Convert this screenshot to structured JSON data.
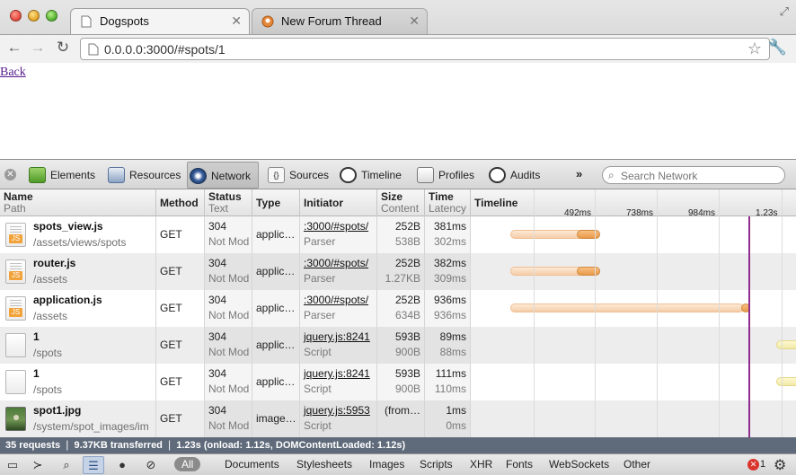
{
  "browser": {
    "tabs": [
      {
        "title": "Dogspots",
        "active": true
      },
      {
        "title": "New Forum Thread",
        "active": false
      }
    ],
    "url": "0.0.0.0:3000/#spots/1"
  },
  "page": {
    "back_link": "Back"
  },
  "devtools": {
    "panels": [
      "Elements",
      "Resources",
      "Network",
      "Sources",
      "Timeline",
      "Profiles",
      "Audits"
    ],
    "selected_panel": "Network",
    "overflow": "»",
    "search_placeholder": "Search Network",
    "columns": {
      "name": "Name",
      "path": "Path",
      "method": "Method",
      "status": "Status",
      "status_text": "Text",
      "type": "Type",
      "initiator": "Initiator",
      "size": "Size",
      "content": "Content",
      "time": "Time",
      "latency": "Latency",
      "timeline": "Timeline"
    },
    "timeline_ticks": [
      "492ms",
      "738ms",
      "984ms",
      "1.23s"
    ],
    "rows": [
      {
        "name": "spots_view.js",
        "path": "/assets/views/spots",
        "method": "GET",
        "status": "304",
        "status_text": "Not Mod",
        "type": "applic…",
        "initiator": ":3000/#spots/",
        "initiator_type": "Parser",
        "size": "252B",
        "content": "538B",
        "time": "381ms",
        "latency": "302ms",
        "icon": "js",
        "bar": {
          "kind": "js",
          "start": 0.0,
          "mid": 0.66,
          "end": 0.89
        }
      },
      {
        "name": "router.js",
        "path": "/assets",
        "method": "GET",
        "status": "304",
        "status_text": "Not Mod",
        "type": "applic…",
        "initiator": ":3000/#spots/",
        "initiator_type": "Parser",
        "size": "252B",
        "content": "1.27KB",
        "time": "382ms",
        "latency": "309ms",
        "icon": "js",
        "bar": {
          "kind": "js",
          "start": 0.0,
          "mid": 0.66,
          "end": 0.89
        }
      },
      {
        "name": "application.js",
        "path": "/assets",
        "method": "GET",
        "status": "304",
        "status_text": "Not Mod",
        "type": "applic…",
        "initiator": ":3000/#spots/",
        "initiator_type": "Parser",
        "size": "252B",
        "content": "634B",
        "time": "936ms",
        "latency": "936ms",
        "icon": "js",
        "bar": {
          "kind": "js",
          "start": 0.0,
          "mid": 0.99,
          "end": 1.0
        }
      },
      {
        "name": "1",
        "path": "/spots",
        "method": "GET",
        "status": "304",
        "status_text": "Not Mod",
        "type": "applic…",
        "initiator": "jquery.js:8241",
        "initiator_type": "Script",
        "size": "593B",
        "content": "900B",
        "time": "89ms",
        "latency": "88ms",
        "icon": "blank",
        "bar": {
          "kind": "xhr",
          "start": 0.0,
          "mid": 0.82,
          "end": 1.0
        }
      },
      {
        "name": "1",
        "path": "/spots",
        "method": "GET",
        "status": "304",
        "status_text": "Not Mod",
        "type": "applic…",
        "initiator": "jquery.js:8241",
        "initiator_type": "Script",
        "size": "593B",
        "content": "900B",
        "time": "111ms",
        "latency": "110ms",
        "icon": "blank",
        "bar": {
          "kind": "xhr",
          "start": 0.0,
          "mid": 0.82,
          "end": 1.0
        }
      },
      {
        "name": "spot1.jpg",
        "path": "/system/spot_images/im",
        "method": "GET",
        "status": "304",
        "status_text": "Not Mod",
        "type": "image…",
        "initiator": "jquery.js:5953",
        "initiator_type": "Script",
        "size": "(from…",
        "content": "",
        "time": "1ms",
        "latency": "0ms",
        "icon": "img",
        "bar": {
          "kind": "img",
          "start": 0.0,
          "mid": 0.0,
          "end": 1.0
        }
      }
    ],
    "summary": "35 requests  ❘  9.37KB transferred  ❘  1.23s (onload: 1.12s, DOMContentLoaded: 1.12s)",
    "filters": [
      "All",
      "Documents",
      "Stylesheets",
      "Images",
      "Scripts",
      "XHR",
      "Fonts",
      "WebSockets",
      "Other"
    ],
    "error_count": "1",
    "colors": {
      "dom_line": "#8e2d8e",
      "summary_bg": "#5f6a7a"
    }
  }
}
